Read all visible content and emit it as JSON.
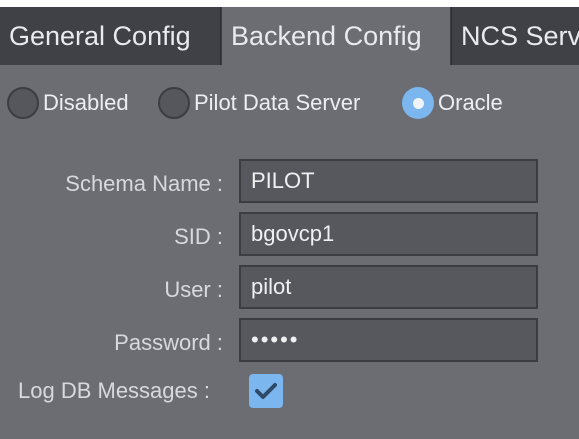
{
  "tabs": [
    {
      "label": "General Config",
      "active": false
    },
    {
      "label": "Backend Config",
      "active": true
    },
    {
      "label": "NCS Serv",
      "active": false
    }
  ],
  "backend": {
    "options": [
      {
        "label": "Disabled",
        "selected": false
      },
      {
        "label": "Pilot Data Server",
        "selected": false
      },
      {
        "label": "Oracle",
        "selected": true
      }
    ],
    "fields": {
      "schema_name": {
        "label": "Schema Name :",
        "value": "PILOT"
      },
      "sid": {
        "label": "SID :",
        "value": "bgovcp1"
      },
      "user": {
        "label": "User :",
        "value": "pilot"
      },
      "password": {
        "label": "Password :",
        "value": "•••••"
      }
    },
    "log_db_messages": {
      "label": "Log DB Messages :",
      "checked": true
    }
  },
  "colors": {
    "accent": "#7bb6ee",
    "panel_bg": "#6b6d72",
    "tabbar_bg": "#3f4146",
    "input_bg": "#56585d"
  },
  "icons": {
    "radio_selected": "radio-checked-icon",
    "radio_unselected": "radio-unchecked-icon",
    "checkbox": "checkmark-icon"
  }
}
